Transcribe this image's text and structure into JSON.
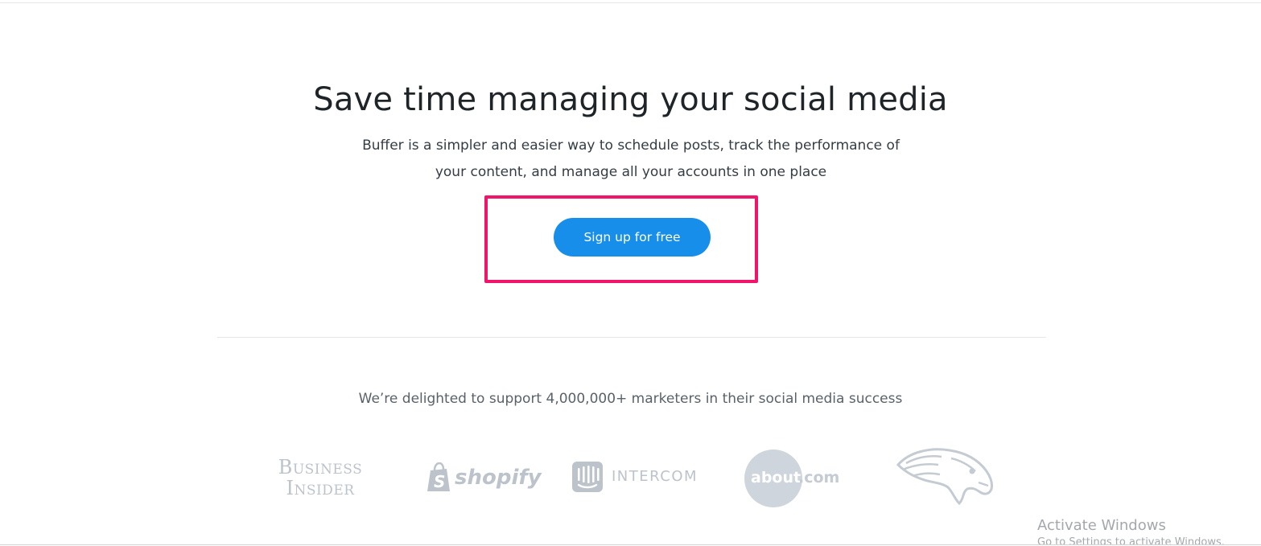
{
  "hero": {
    "title": "Save time managing your social media",
    "subtitle": "Buffer is a simpler and easier way to schedule posts, track the performance of your content, and manage all your accounts in one place",
    "cta_label": "Sign up for free"
  },
  "social_proof": {
    "text": "We’re delighted to support 4,000,000+ marketers in their social media success",
    "logos": {
      "business_insider": {
        "line1": "Business",
        "line2": "Insider"
      },
      "shopify": "shopify",
      "intercom": "INTERCOM",
      "about": {
        "main": "about",
        "suffix": ".com"
      },
      "broncos": "broncos-horse-logo"
    }
  },
  "windows_watermark": {
    "title": "Activate Windows",
    "subtitle": "Go to Settings to activate Windows."
  },
  "colors": {
    "button": "#168eea",
    "highlight": "#f0156b",
    "logo_gray": "#bcc3cb"
  }
}
